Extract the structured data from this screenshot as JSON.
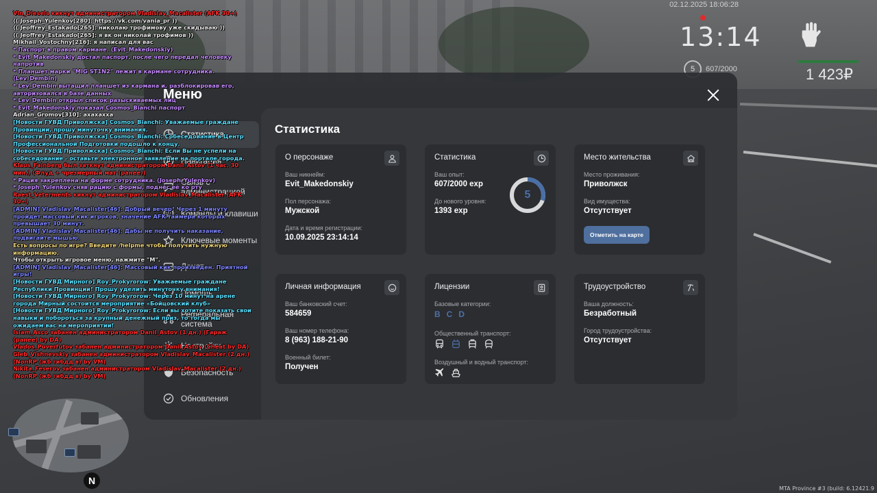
{
  "hud": {
    "datetime": "02.12.2025 18:06:28",
    "clock": "13:14",
    "level": "5",
    "exp": "607/2000",
    "money": "1 423₽"
  },
  "colors": {
    "accent": "#4f6f9e",
    "panel": "#2c2e32",
    "content": "#35373b",
    "card": "#2b2d31",
    "health": "#2c7b3c"
  },
  "menu": {
    "title": "Меню",
    "nav": [
      {
        "label": "Статистика",
        "icon": "stats-icon"
      },
      {
        "label": "Навигация",
        "icon": "compass-icon"
      },
      {
        "label": "Связь с администрацией",
        "icon": "chat-icon"
      },
      {
        "label": "Команды и клавиши",
        "icon": "keyboard-icon"
      },
      {
        "label": "Ключевые моменты",
        "icon": "star-icon"
      },
      {
        "label": "Донат",
        "icon": "wallet-icon"
      },
      {
        "label": "Помощь",
        "icon": "heart-icon"
      },
      {
        "label": "Реферальная система",
        "icon": "people-icon"
      },
      {
        "label": "Настройки",
        "icon": "gear-icon"
      },
      {
        "label": "Безопасность",
        "icon": "shield-icon"
      },
      {
        "label": "Обновления",
        "icon": "check-circle-icon"
      }
    ]
  },
  "content": {
    "title": "Статистика",
    "character": {
      "title": "О персонаже",
      "nick_label": "Ваш никнейм:",
      "nick": "Evit_Makedonskiy",
      "gender_label": "Пол персонажа:",
      "gender": "Мужской",
      "reg_label": "Дата и время регистрации:",
      "reg": "10.09.2025 23:14:14"
    },
    "stats": {
      "title": "Статистика",
      "exp_label": "Ваш опыт:",
      "exp": "607/2000 exp",
      "next_label": "До нового уровня:",
      "next": "1393 exp",
      "level": "5",
      "progress": 0.3035
    },
    "residence": {
      "title": "Место жительства",
      "place_label": "Место проживания:",
      "place": "Приволжск",
      "property_label": "Вид имущества:",
      "property": "Отсутствует",
      "button": "Отметить на карте"
    },
    "personal": {
      "title": "Личная информация",
      "bank_label": "Ваш банковский счет:",
      "bank": "584659",
      "phone_label": "Ваш номер телефона:",
      "phone": "8 (963) 188-21-90",
      "military_label": "Военный билет:",
      "military": "Получен"
    },
    "licenses": {
      "title": "Лицензии",
      "base_label": "Базовые категории:",
      "categories": [
        "B",
        "C",
        "D"
      ],
      "public_label": "Общественный транспорт:",
      "air_label": "Воздушный и водный транспорт:"
    },
    "employment": {
      "title": "Трудоустройство",
      "position_label": "Ваша должность:",
      "position": "Безработный",
      "city_label": "Город трудоустройства:",
      "city": "Отсутствует"
    }
  },
  "chat": [
    {
      "text": "Vin_Diesels кикнут администратором Vladislav_Macalister (AFK 30+)",
      "color": "#ff2a2a"
    },
    {
      "text": "(( Joseph_Yulenkov[280]: https://vk.com/vania_pr ))",
      "color": "#e6e6e6"
    },
    {
      "text": "(( Jeoffrey_Estakado[265]: николаю трофимову уже скидываю ))",
      "color": "#e6e6e6"
    },
    {
      "text": "(( Jeoffrey_Estakado[265]: я вк он николай трофимов ))",
      "color": "#e6e6e6"
    },
    {
      "text": "Mikhail_Vostochny[216]: я написал для вас",
      "color": "#e6e6e6"
    },
    {
      "text": "* Паспорт в правом кармане. (Evit_Makedonskiy)",
      "color": "#c58cff"
    },
    {
      "text": "* Evit_Makedonskiy достал паспорт, после чего передал человеку напротив",
      "color": "#c58cff"
    },
    {
      "text": "* Планшет марки \"MIG ST1N2\" лежит в кармане сотрудника. (Lev_Dembin)",
      "color": "#c58cff"
    },
    {
      "text": "* Lev_Dembin вытащил планшет из кармана и, разблокировав его, авторизовался в базе данных",
      "color": "#c58cff"
    },
    {
      "text": "* Lev_Dembin открыл список разыскиваемых лиц",
      "color": "#c58cff"
    },
    {
      "text": "* Evit_Makedonskiy показал Cosmos_Bianchi паспорт",
      "color": "#c58cff"
    },
    {
      "text": "Adrian_Gromov[310]: ахахахха",
      "color": "#e6e6e6"
    },
    {
      "text": "[Новости ГУВД Приволжска] Cosmos_Bianchi: Уважаемые граждане Провинции, прошу минуточку внимания.",
      "color": "#5ce0ff"
    },
    {
      "text": "[Новости ГУВД Приволжска] Cosmos_Bianchi: Собеседование в Центр Профессиональной Подготовки подошло к концу.",
      "color": "#5ce0ff"
    },
    {
      "text": "[Новости ГУВД Приволжска] Cosmos_Bianchi: Если Вы не успели на собеседование - оставьте электронное заявление на портале города.",
      "color": "#5ce0ff"
    },
    {
      "text": "Klaus_Fainberg был заткнут администратором Danil_Astov (1 час. 30 мин.) (Флуд + чрезмерный мат (ранее))",
      "color": "#ff2a2a"
    },
    {
      "text": "* Рация закреплена на форме сотрудника. (Joseph_Yulenkov)",
      "color": "#c58cff"
    },
    {
      "text": "* Joseph_Yulenkov сняв рацию с формы, поднёс её ко рту",
      "color": "#c58cff"
    },
    {
      "text": "Raest_Veterments кикнут администратором Vladislav_Macalister (AFK 30+)",
      "color": "#ff2a2a"
    },
    {
      "text": "[ADMIN] Vladislav_Macalister[46]: Добрый вечер! Через 1 минуту пройдет массовый кик игроков, значение AFK-таймера которых превышает 30 минут.",
      "color": "#7f86ff"
    },
    {
      "text": "[ADMIN] Vladislav_Macalister[46]: Дабы не получить наказание, подвигайте мышью.",
      "color": "#7f86ff"
    },
    {
      "text": "Есть вопросы по игре? Введите /helpme чтобы получить нужную информацию.",
      "color": "#f2d77a"
    },
    {
      "text": "Чтобы открыть игровое меню, нажмите \"M\".",
      "color": "#e6e6e6"
    },
    {
      "text": "[ADMIN] Vladislav_Macalister[46]: Массовый кик произведен. Приятной игры!",
      "color": "#7f86ff"
    },
    {
      "text": "[Новости ГУВД Мирного] Roy_Prokyrorow: Уважаемые граждане Республики Провинции! Прошу уделить минуточку внимания!",
      "color": "#5ce0ff"
    },
    {
      "text": "[Новости ГУВД Мирного] Roy_Prokyrorow: Через 10 минут на арене города Мирный состоится мероприятие «Бойцовский клуб»",
      "color": "#5ce0ff"
    },
    {
      "text": "[Новости ГУВД Мирного] Roy_Prokyrorow: Если вы хотите показать свои навыки и побороться за крупный денежный приз, то тогда мы ожидаем вас на мероприятии!",
      "color": "#5ce0ff"
    },
    {
      "text": "Islam_Asco забанен администратором Danil_Astov (1 дн.) (Гараж (ранее) by DA)",
      "color": "#ff2a2a"
    },
    {
      "text": "Vlados_Puverfutov забанен администратором Danil_Astov (Cheat by DA)",
      "color": "#ff2a2a"
    },
    {
      "text": "Gleb_Vishnevskiy забанен администратором Vladislav_Macalister (2 дн.) (NonRP (жб гибдд в) by VM)",
      "color": "#ff2a2a"
    },
    {
      "text": "Nikita_Feserov забанен администратором Vladislav_Macalister (2 дн.) (NonRP (жб гибдд в) by VM)",
      "color": "#ff2a2a"
    }
  ],
  "watermark": "MTA Province #3 (build: 6.12421.9"
}
